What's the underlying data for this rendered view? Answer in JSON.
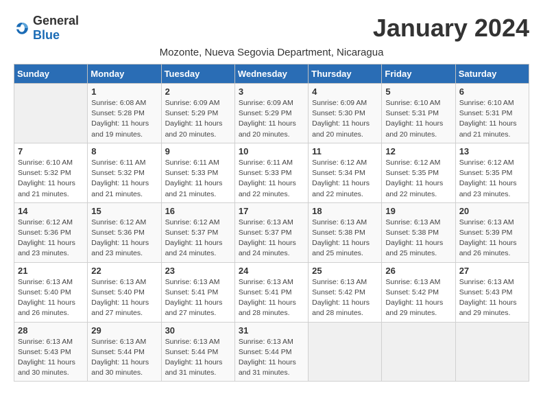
{
  "logo": {
    "general": "General",
    "blue": "Blue"
  },
  "title": "January 2024",
  "subtitle": "Mozonte, Nueva Segovia Department, Nicaragua",
  "weekdays": [
    "Sunday",
    "Monday",
    "Tuesday",
    "Wednesday",
    "Thursday",
    "Friday",
    "Saturday"
  ],
  "weeks": [
    [
      {
        "day": "",
        "detail": ""
      },
      {
        "day": "1",
        "detail": "Sunrise: 6:08 AM\nSunset: 5:28 PM\nDaylight: 11 hours\nand 19 minutes."
      },
      {
        "day": "2",
        "detail": "Sunrise: 6:09 AM\nSunset: 5:29 PM\nDaylight: 11 hours\nand 20 minutes."
      },
      {
        "day": "3",
        "detail": "Sunrise: 6:09 AM\nSunset: 5:29 PM\nDaylight: 11 hours\nand 20 minutes."
      },
      {
        "day": "4",
        "detail": "Sunrise: 6:09 AM\nSunset: 5:30 PM\nDaylight: 11 hours\nand 20 minutes."
      },
      {
        "day": "5",
        "detail": "Sunrise: 6:10 AM\nSunset: 5:31 PM\nDaylight: 11 hours\nand 20 minutes."
      },
      {
        "day": "6",
        "detail": "Sunrise: 6:10 AM\nSunset: 5:31 PM\nDaylight: 11 hours\nand 21 minutes."
      }
    ],
    [
      {
        "day": "7",
        "detail": "Sunrise: 6:10 AM\nSunset: 5:32 PM\nDaylight: 11 hours\nand 21 minutes."
      },
      {
        "day": "8",
        "detail": "Sunrise: 6:11 AM\nSunset: 5:32 PM\nDaylight: 11 hours\nand 21 minutes."
      },
      {
        "day": "9",
        "detail": "Sunrise: 6:11 AM\nSunset: 5:33 PM\nDaylight: 11 hours\nand 21 minutes."
      },
      {
        "day": "10",
        "detail": "Sunrise: 6:11 AM\nSunset: 5:33 PM\nDaylight: 11 hours\nand 22 minutes."
      },
      {
        "day": "11",
        "detail": "Sunrise: 6:12 AM\nSunset: 5:34 PM\nDaylight: 11 hours\nand 22 minutes."
      },
      {
        "day": "12",
        "detail": "Sunrise: 6:12 AM\nSunset: 5:35 PM\nDaylight: 11 hours\nand 22 minutes."
      },
      {
        "day": "13",
        "detail": "Sunrise: 6:12 AM\nSunset: 5:35 PM\nDaylight: 11 hours\nand 23 minutes."
      }
    ],
    [
      {
        "day": "14",
        "detail": "Sunrise: 6:12 AM\nSunset: 5:36 PM\nDaylight: 11 hours\nand 23 minutes."
      },
      {
        "day": "15",
        "detail": "Sunrise: 6:12 AM\nSunset: 5:36 PM\nDaylight: 11 hours\nand 23 minutes."
      },
      {
        "day": "16",
        "detail": "Sunrise: 6:12 AM\nSunset: 5:37 PM\nDaylight: 11 hours\nand 24 minutes."
      },
      {
        "day": "17",
        "detail": "Sunrise: 6:13 AM\nSunset: 5:37 PM\nDaylight: 11 hours\nand 24 minutes."
      },
      {
        "day": "18",
        "detail": "Sunrise: 6:13 AM\nSunset: 5:38 PM\nDaylight: 11 hours\nand 25 minutes."
      },
      {
        "day": "19",
        "detail": "Sunrise: 6:13 AM\nSunset: 5:38 PM\nDaylight: 11 hours\nand 25 minutes."
      },
      {
        "day": "20",
        "detail": "Sunrise: 6:13 AM\nSunset: 5:39 PM\nDaylight: 11 hours\nand 26 minutes."
      }
    ],
    [
      {
        "day": "21",
        "detail": "Sunrise: 6:13 AM\nSunset: 5:40 PM\nDaylight: 11 hours\nand 26 minutes."
      },
      {
        "day": "22",
        "detail": "Sunrise: 6:13 AM\nSunset: 5:40 PM\nDaylight: 11 hours\nand 27 minutes."
      },
      {
        "day": "23",
        "detail": "Sunrise: 6:13 AM\nSunset: 5:41 PM\nDaylight: 11 hours\nand 27 minutes."
      },
      {
        "day": "24",
        "detail": "Sunrise: 6:13 AM\nSunset: 5:41 PM\nDaylight: 11 hours\nand 28 minutes."
      },
      {
        "day": "25",
        "detail": "Sunrise: 6:13 AM\nSunset: 5:42 PM\nDaylight: 11 hours\nand 28 minutes."
      },
      {
        "day": "26",
        "detail": "Sunrise: 6:13 AM\nSunset: 5:42 PM\nDaylight: 11 hours\nand 29 minutes."
      },
      {
        "day": "27",
        "detail": "Sunrise: 6:13 AM\nSunset: 5:43 PM\nDaylight: 11 hours\nand 29 minutes."
      }
    ],
    [
      {
        "day": "28",
        "detail": "Sunrise: 6:13 AM\nSunset: 5:43 PM\nDaylight: 11 hours\nand 30 minutes."
      },
      {
        "day": "29",
        "detail": "Sunrise: 6:13 AM\nSunset: 5:44 PM\nDaylight: 11 hours\nand 30 minutes."
      },
      {
        "day": "30",
        "detail": "Sunrise: 6:13 AM\nSunset: 5:44 PM\nDaylight: 11 hours\nand 31 minutes."
      },
      {
        "day": "31",
        "detail": "Sunrise: 6:13 AM\nSunset: 5:44 PM\nDaylight: 11 hours\nand 31 minutes."
      },
      {
        "day": "",
        "detail": ""
      },
      {
        "day": "",
        "detail": ""
      },
      {
        "day": "",
        "detail": ""
      }
    ]
  ]
}
